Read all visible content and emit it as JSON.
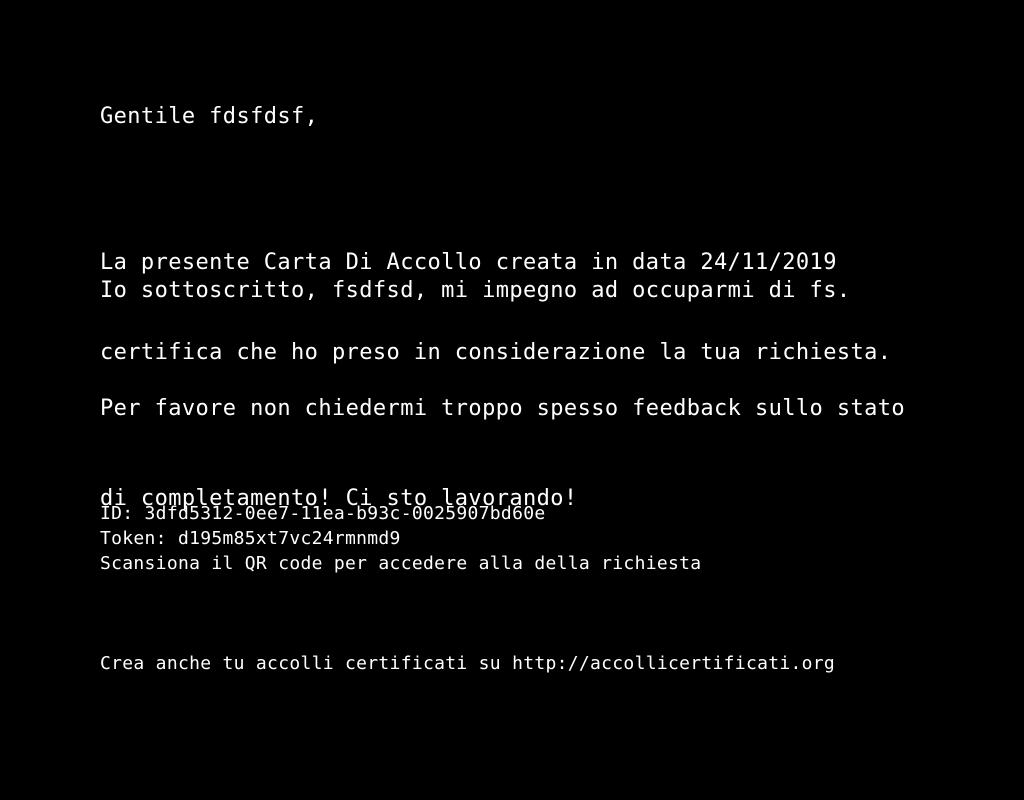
{
  "letter": {
    "greeting": "Gentile fdsfdsf,",
    "paragraph1": [
      "La presente Carta Di Accollo creata in data 24/11/2019",
      "certifica che ho preso in considerazione la tua richiesta."
    ],
    "paragraph2": "Io sottoscritto, fsdfsd, mi impegno ad occuparmi di fs.",
    "paragraph3": [
      "Per favore non chiedermi troppo spesso feedback sullo stato",
      "di completamento! Ci sto lavorando!"
    ]
  },
  "meta": {
    "id": "ID: 3dfd5312-0ee7-11ea-b93c-0025907bd60e",
    "token": "Token: d195m85xt7vc24rmnmd9",
    "scan_instruction": "Scansiona il QR code per accedere alla della richiesta"
  },
  "footer": {
    "text": "Crea anche tu accolli certificati su http://accollicertificati.org"
  },
  "colors": {
    "background": "#000000",
    "text": "#ffffff"
  }
}
